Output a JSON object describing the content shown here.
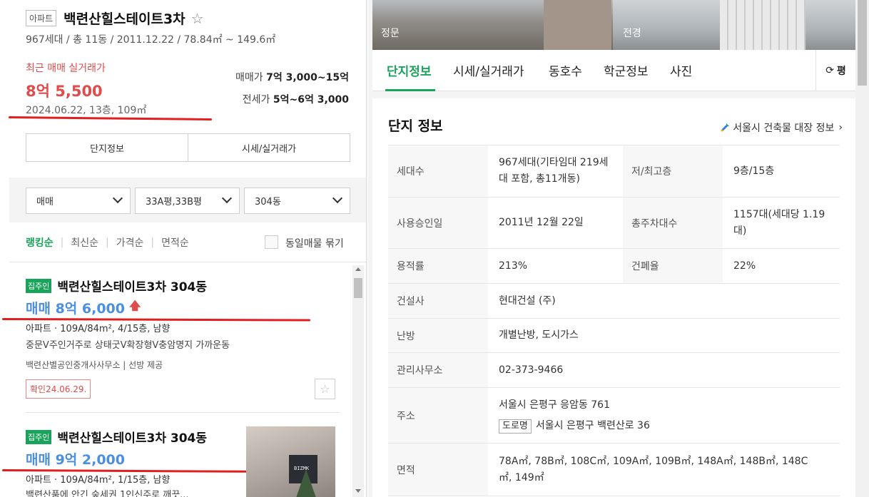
{
  "left": {
    "type_badge": "아파트",
    "title": "백련산힐스테이트3차",
    "meta": "967세대 / 총 11동 / 2011.12.22 / 78.84㎡ ~ 149.6㎡",
    "recent": {
      "label": "최근 매매 실거래가",
      "price": "8억 5,500",
      "detail": "2024.06.22, 13층, 109㎡"
    },
    "sale_range_label": "매매가",
    "sale_range": "7억 3,000~15억",
    "jeonse_range_label": "전세가",
    "jeonse_range": "5억~6억 3,000",
    "buttons": [
      "단지정보",
      "시세/실거래가"
    ],
    "filters": [
      {
        "value": "매매"
      },
      {
        "value": "33A평,33B평"
      },
      {
        "value": "304동"
      }
    ],
    "sorts": [
      "랭킹순",
      "최신순",
      "가격순",
      "면적순"
    ],
    "group_label": "동일매물 묶기",
    "listings": [
      {
        "badge": "집주인",
        "title": "백련산힐스테이트3차 304동",
        "price": "매매 8억 6,000",
        "spec": "아파트 · 109A/84m², 4/15층, 남향",
        "desc": "중문V주인거주로 상태굿V확장형V충암명지 가까운동",
        "agent": "백련산별공인중개사사무소 | 선방 제공",
        "confirm": "확인24.06.29."
      },
      {
        "badge": "집주인",
        "title": "백련산힐스테이트3차 304동",
        "price": "매매 9억 2,000",
        "spec": "아파트 · 109A/84m², 1/15층, 남향",
        "desc": "백련산품에 안긴 숲세권 1인신주로 깨끗...",
        "thumb_logo": "BIZMK"
      }
    ]
  },
  "right": {
    "photos": [
      {
        "caption": "정문"
      },
      {
        "caption": "전경"
      }
    ],
    "tabs": [
      "단지정보",
      "시세/실거래가",
      "동호수",
      "학군정보",
      "사진"
    ],
    "unit_label": "평",
    "card_title": "단지 정보",
    "registry_link": "서울시 건축물 대장 정보",
    "info": {
      "households_k": "세대수",
      "households_v": "967세대(기타임대 219세대 포함, 총11개동)",
      "floors_k": "저/최고층",
      "floors_v": "9층/15층",
      "approval_k": "사용승인일",
      "approval_v": "2011년 12월 22일",
      "parking_k": "총주차대수",
      "parking_v": "1157대(세대당 1.19대)",
      "far_k": "용적률",
      "far_v": "213%",
      "bcr_k": "건폐율",
      "bcr_v": "22%",
      "builder_k": "건설사",
      "builder_v": "현대건설 (주)",
      "heating_k": "난방",
      "heating_v": "개별난방, 도시가스",
      "office_k": "관리사무소",
      "office_v": "02-373-9466",
      "address_k": "주소",
      "address_v": "서울시 은평구 응암동 761",
      "road_badge": "도로명",
      "road_v": "서울시 은평구 백련산로 36",
      "area_k": "면적",
      "area_v": "78A㎡, 78B㎡, 108C㎡, 109A㎡, 109B㎡, 148A㎡, 148B㎡, 148C㎡, 149㎡"
    }
  }
}
